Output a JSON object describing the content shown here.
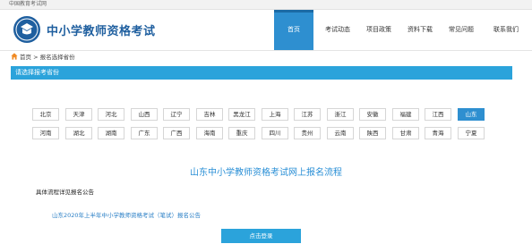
{
  "topbar": {
    "text": "中国教育考试网"
  },
  "header": {
    "title": "中小学教师资格考试"
  },
  "nav": {
    "items": [
      {
        "label": "首页",
        "active": true
      },
      {
        "label": "考试动态",
        "active": false
      },
      {
        "label": "项目政策",
        "active": false
      },
      {
        "label": "资料下载",
        "active": false
      },
      {
        "label": "常见问题",
        "active": false
      },
      {
        "label": "联系我们",
        "active": false
      }
    ]
  },
  "breadcrumb": {
    "home": "首页",
    "separator": ">",
    "current": "报名选择省份"
  },
  "section": {
    "title": "请选择报考省份"
  },
  "provinces": {
    "selected": "山东",
    "row1": [
      "北京",
      "天津",
      "河北",
      "山西",
      "辽宁",
      "吉林",
      "黑龙江",
      "上海",
      "江苏",
      "浙江",
      "安徽",
      "福建",
      "江西",
      "山东"
    ],
    "row2": [
      "河南",
      "湖北",
      "湖南",
      "广东",
      "广西",
      "海南",
      "重庆",
      "四川",
      "贵州",
      "云南",
      "陕西",
      "甘肃",
      "青海",
      "宁夏"
    ]
  },
  "content": {
    "title": "山东中小学教师资格考试网上报名流程",
    "notice_label": "具体流程详见报名公告",
    "notice_link": "山东2020年上半年中小学教师资格考试（笔试）报名公告"
  },
  "login_button": {
    "label": "点击登录"
  },
  "colors": {
    "accent": "#2ba3db",
    "brand": "#1f5f9f",
    "nav_active": "#2e8fd0"
  },
  "icons": {
    "logo": "exam-logo-icon",
    "home": "home-icon"
  }
}
